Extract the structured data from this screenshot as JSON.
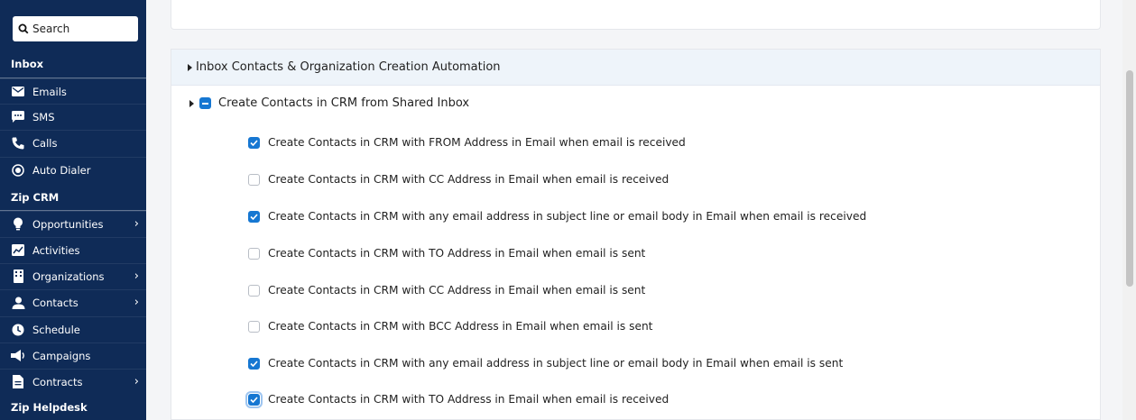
{
  "sidebar": {
    "search_placeholder": "Search",
    "sections": [
      {
        "title": "Inbox"
      },
      {
        "title": "Zip CRM"
      },
      {
        "title": "Zip Helpdesk"
      }
    ],
    "inbox_items": [
      {
        "label": "Emails",
        "icon": "mail-icon"
      },
      {
        "label": "SMS",
        "icon": "chat-icon"
      },
      {
        "label": "Calls",
        "icon": "phone-icon"
      },
      {
        "label": "Auto Dialer",
        "icon": "dialer-icon"
      }
    ],
    "crm_items": [
      {
        "label": "Opportunities",
        "icon": "lightbulb-icon",
        "has_submenu": true
      },
      {
        "label": "Activities",
        "icon": "activity-chart-icon",
        "has_submenu": false
      },
      {
        "label": "Organizations",
        "icon": "building-icon",
        "has_submenu": true
      },
      {
        "label": "Contacts",
        "icon": "person-icon",
        "has_submenu": true
      },
      {
        "label": "Schedule",
        "icon": "clock-icon",
        "has_submenu": false
      },
      {
        "label": "Campaigns",
        "icon": "megaphone-icon",
        "has_submenu": false
      },
      {
        "label": "Contracts",
        "icon": "document-icon",
        "has_submenu": true
      }
    ]
  },
  "panel": {
    "title": "Inbox Contacts & Organization Creation Automation",
    "group_label": "Create Contacts in CRM from Shared Inbox",
    "options": [
      {
        "label": "Create Contacts in CRM with FROM Address in Email when email is received",
        "checked": true
      },
      {
        "label": "Create Contacts in CRM with CC Address in Email when email is received",
        "checked": false
      },
      {
        "label": "Create Contacts in CRM with any email address in subject line or email body in Email when email is received",
        "checked": true
      },
      {
        "label": "Create Contacts in CRM with TO Address in Email when email is sent",
        "checked": false
      },
      {
        "label": "Create Contacts in CRM with CC Address in Email when email is sent",
        "checked": false
      },
      {
        "label": "Create Contacts in CRM with BCC Address in Email when email is sent",
        "checked": false
      },
      {
        "label": "Create Contacts in CRM with any email address in subject line or email body in Email when email is sent",
        "checked": true
      },
      {
        "label": "Create Contacts in CRM with TO Address in Email when email is received",
        "checked": true
      }
    ]
  },
  "colors": {
    "sidebar_bg": "#0f2b57",
    "accent": "#1677d2",
    "panel_header_bg": "#eef4fa"
  }
}
